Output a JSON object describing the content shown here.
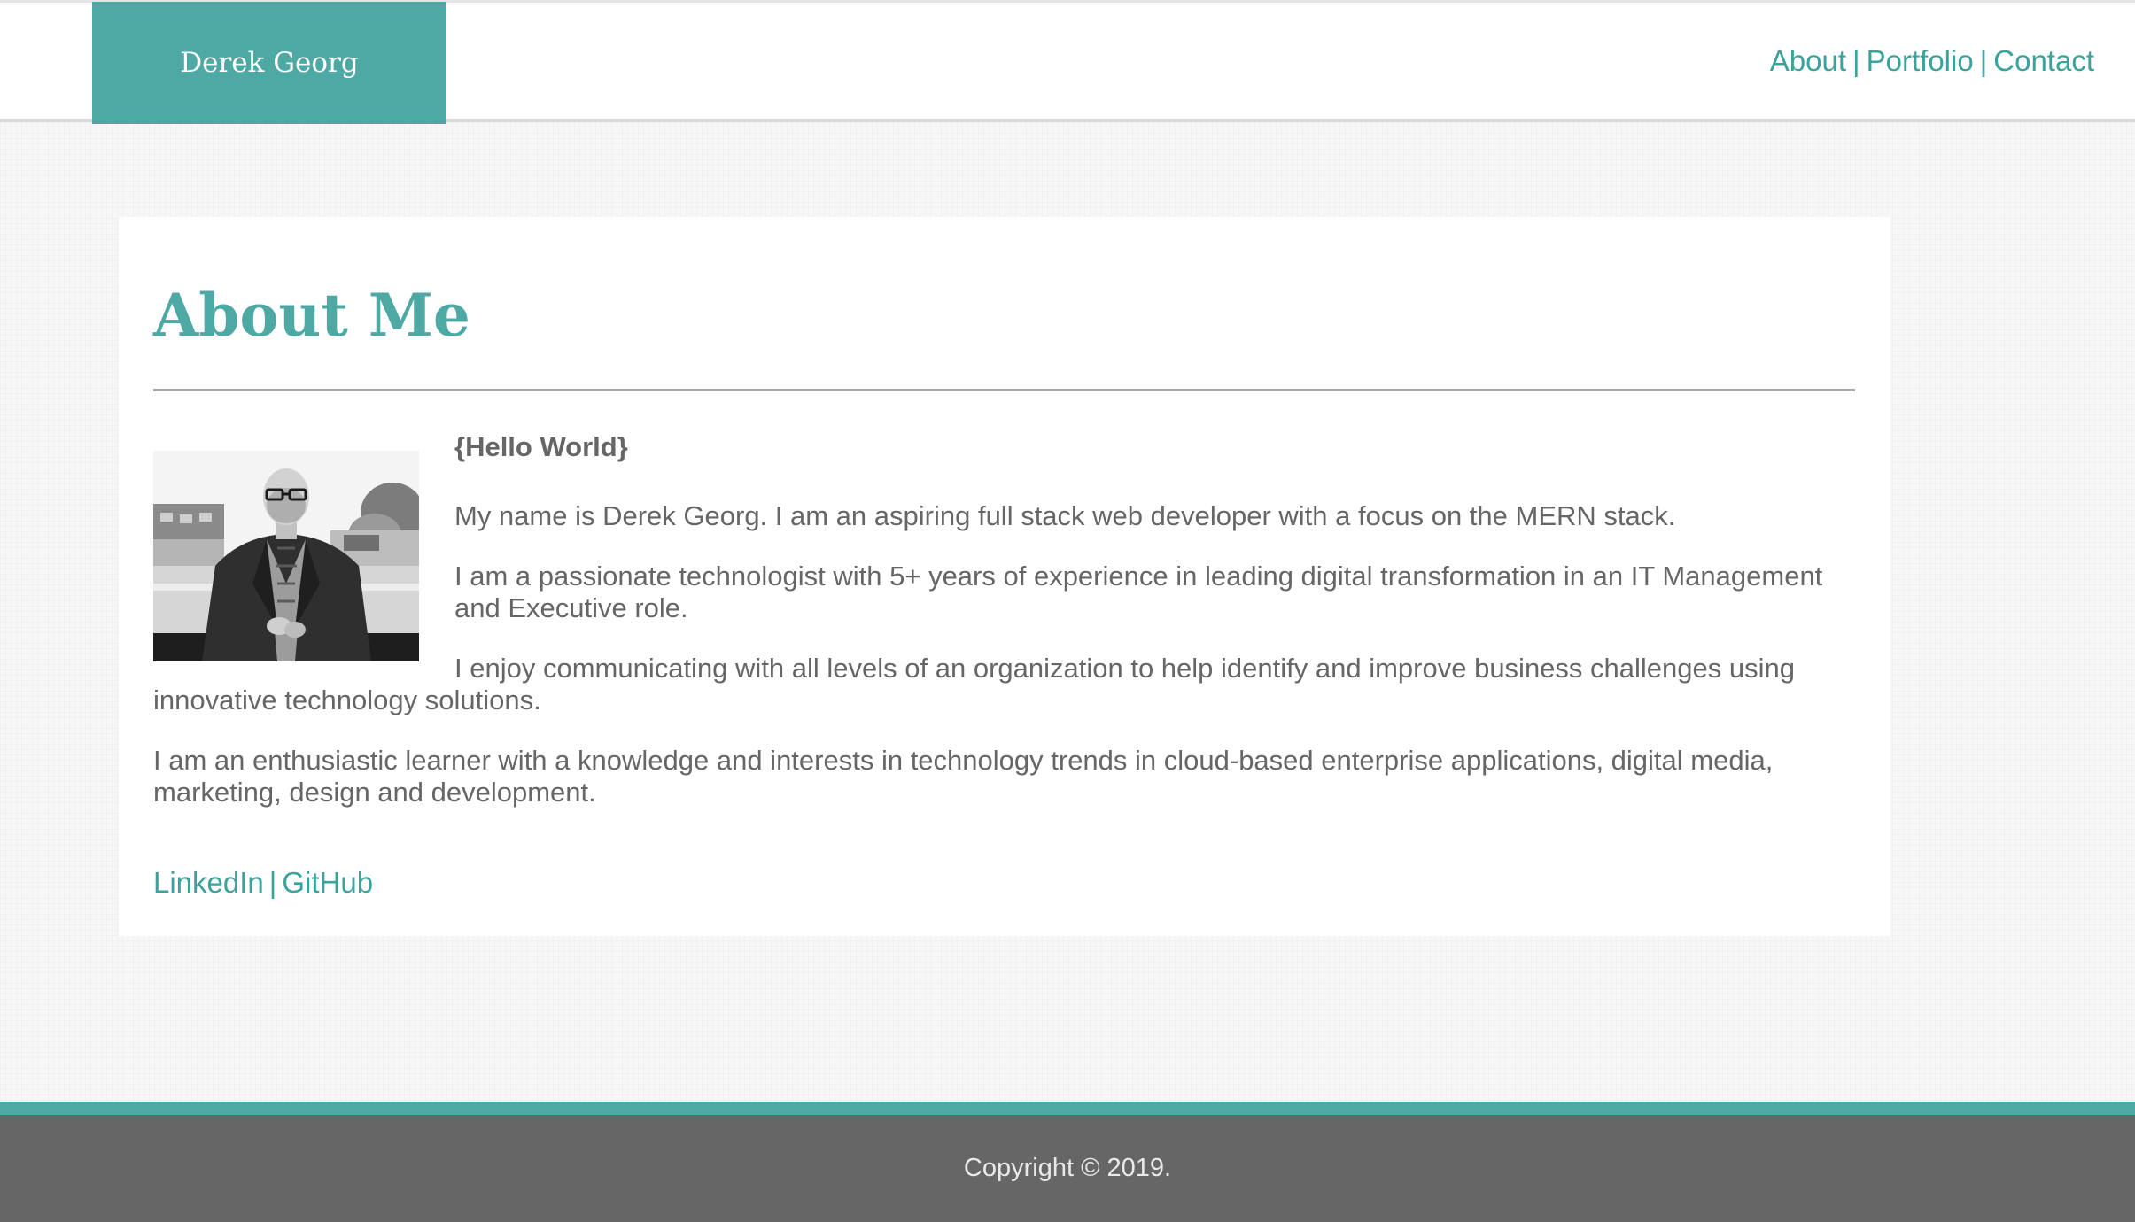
{
  "header": {
    "brand": "Derek Georg",
    "nav": {
      "about": "About",
      "portfolio": "Portfolio",
      "contact": "Contact",
      "separator": "|"
    }
  },
  "main": {
    "title": "About Me",
    "greeting": "{Hello World}",
    "paragraphs": [
      "My name is Derek Georg. I am an aspiring full stack web developer with a focus on the MERN stack.",
      "I am a passionate technologist with 5+ years of experience in leading digital transformation in an IT Management and Executive role.",
      "I enjoy communicating with all levels of an organization to help identify and improve business challenges using innovative technology solutions.",
      "I am an enthusiastic learner with a knowledge and interests in technology trends in cloud-based enterprise applications, digital media, marketing, design and development."
    ],
    "social": {
      "linkedin": "LinkedIn",
      "github": "GitHub",
      "separator": "|"
    }
  },
  "footer": {
    "copyright": "Copyright © 2019."
  },
  "colors": {
    "accent": "#4ea9a4",
    "link": "#3aa39c",
    "text": "#666666",
    "footer_bg": "#666666"
  }
}
